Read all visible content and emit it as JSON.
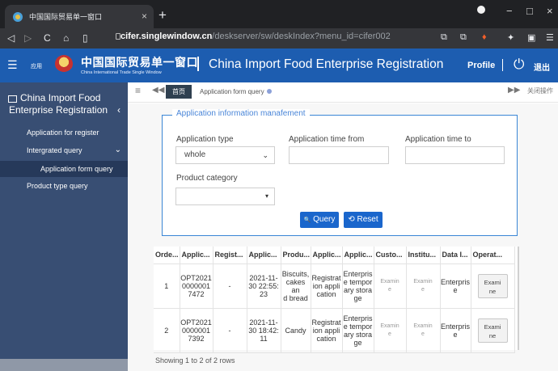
{
  "browser": {
    "tab_title": "中国国际贸易单一窗口",
    "tab_close": "×",
    "new_tab": "+",
    "window_buttons": [
      "−",
      "□",
      "×"
    ],
    "nav": {
      "back": "◁",
      "forward": "▷",
      "reload": "C",
      "home": "⌂",
      "bookmark": "▯"
    },
    "address_host": "cifer.singlewindow.cn",
    "address_path": "/deskserver/sw/deskIndex?menu_id=cifer002",
    "toolbar_icons": [
      "⧉",
      "⧉",
      "♦",
      "✦",
      "▣",
      "☰"
    ]
  },
  "header": {
    "menu_icon": "☰",
    "apps_label": "应用",
    "logo_cn": "中国国际贸易单一窗口",
    "logo_en": "China International Trade Single Window",
    "title": "China Import Food Enterprise Registration",
    "profile": "Profile",
    "power_icon": "⏻",
    "logout": "退出",
    "brand_color": "#1d5db0"
  },
  "sidebar": {
    "title": "China Import Food Enterprise Registration",
    "collapse_icon": "‹",
    "items": [
      {
        "label": "Application for register"
      },
      {
        "label": "Intergrated query",
        "arrow": "⌄"
      },
      {
        "label": "Application form query"
      },
      {
        "label": "Product type query"
      }
    ],
    "background": "#384e73"
  },
  "tabs": {
    "menu_icon": "≡",
    "back_icon": "◀◀",
    "home": "首页",
    "active": "Application form query",
    "forward_icon": "▶▶",
    "close_ops": "关闭操作"
  },
  "form": {
    "legend": "Application information manafement",
    "application_type_label": "Application type",
    "application_type_value": "whole",
    "time_from_label": "Application time from",
    "time_from_value": "",
    "time_to_label": "Application time to",
    "time_to_value": "",
    "product_category_label": "Product category",
    "product_category_value": "",
    "select_arrow": "⌄",
    "dropdown_arrow": "▾",
    "query": "Query",
    "reset": "Reset",
    "query_icon": "🔍",
    "reset_icon": "⟲"
  },
  "table": {
    "headers": [
      "Orde...",
      "Applic...",
      "Regist...",
      "Applic...",
      "Produ...",
      "Applic...",
      "Applic...",
      "Custo...",
      "Institu...",
      "Data I...",
      "Operat..."
    ],
    "rows": [
      [
        "1",
        "OPT2021\n0000001\n7472",
        "-",
        "2021-11-\n30 22:55:\n23",
        "Biscuits,\ncakes an\nd bread",
        "Registrat\nion appli\ncation",
        "Enterpris\ne tempor\nary stora\nge",
        "Examin\ne",
        "Examin\ne",
        "Enterpris\ne",
        "Exami\nne"
      ],
      [
        "2",
        "OPT2021\n0000001\n7392",
        "-",
        "2021-11-\n30 18:42:\n11",
        "Candy",
        "Registrat\nion appli\ncation",
        "Enterpris\ne tempor\nary stora\nge",
        "Examin\ne",
        "Examin\ne",
        "Enterpris\ne",
        "Exami\nne"
      ]
    ]
  },
  "pagination": {
    "summary": "Showing 1 to 2 of 2 rows"
  }
}
